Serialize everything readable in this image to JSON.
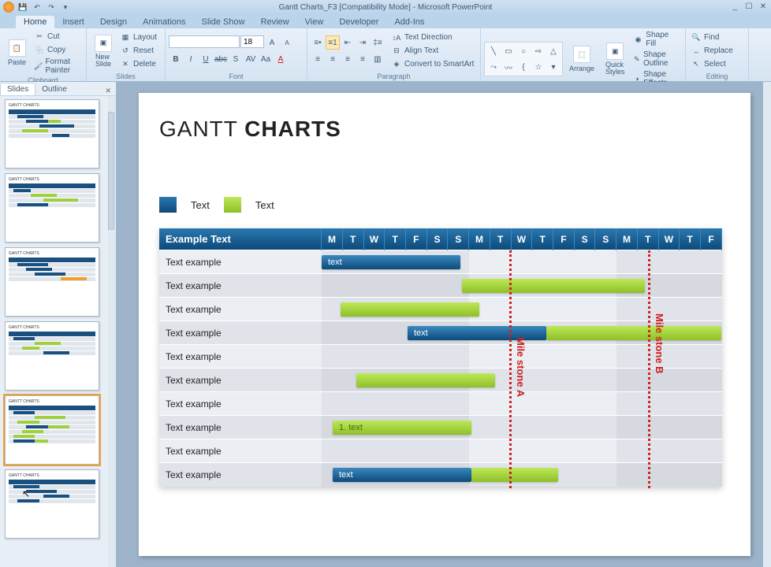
{
  "window": {
    "title": "Gantt Charts_F3 [Compatibility Mode] - Microsoft PowerPoint"
  },
  "ribbon_tabs": [
    "Home",
    "Insert",
    "Design",
    "Animations",
    "Slide Show",
    "Review",
    "View",
    "Developer",
    "Add-Ins"
  ],
  "ribbon": {
    "clipboard": {
      "paste": "Paste",
      "cut": "Cut",
      "copy": "Copy",
      "format_painter": "Format Painter",
      "label": "Clipboard"
    },
    "slides": {
      "new_slide": "New\nSlide",
      "layout": "Layout",
      "reset": "Reset",
      "delete": "Delete",
      "label": "Slides"
    },
    "font": {
      "size": "18",
      "label": "Font"
    },
    "paragraph": {
      "text_direction": "Text Direction",
      "align_text": "Align Text",
      "convert_smartart": "Convert to SmartArt",
      "label": "Paragraph"
    },
    "drawing": {
      "arrange": "Arrange",
      "quick_styles": "Quick\nStyles",
      "shape_fill": "Shape Fill",
      "shape_outline": "Shape Outline",
      "shape_effects": "Shape Effects",
      "label": "Drawing"
    },
    "editing": {
      "find": "Find",
      "replace": "Replace",
      "select": "Select",
      "label": "Editing"
    }
  },
  "slide_panel": {
    "tabs": [
      "Slides",
      "Outline"
    ]
  },
  "slide": {
    "title_light": "GANTT ",
    "title_bold": "CHARTS",
    "legend": {
      "item1": "Text",
      "item2": "Text"
    },
    "header": {
      "task": "Example Text",
      "days": [
        "M",
        "T",
        "W",
        "T",
        "F",
        "S",
        "S",
        "M",
        "T",
        "W",
        "T",
        "F",
        "S",
        "S",
        "M",
        "T",
        "W",
        "T",
        "F"
      ]
    },
    "rows": [
      "Text example",
      "Text example",
      "Text example",
      "Text example",
      "Text example",
      "Text example",
      "Text example",
      "Text example",
      "Text example",
      "Text example"
    ],
    "bar_labels": {
      "b1": "text",
      "b4": "text",
      "b8": "1.    text",
      "b10": "text"
    },
    "milestones": {
      "a": "Mile stone A",
      "b": "Mile stone B"
    }
  }
}
